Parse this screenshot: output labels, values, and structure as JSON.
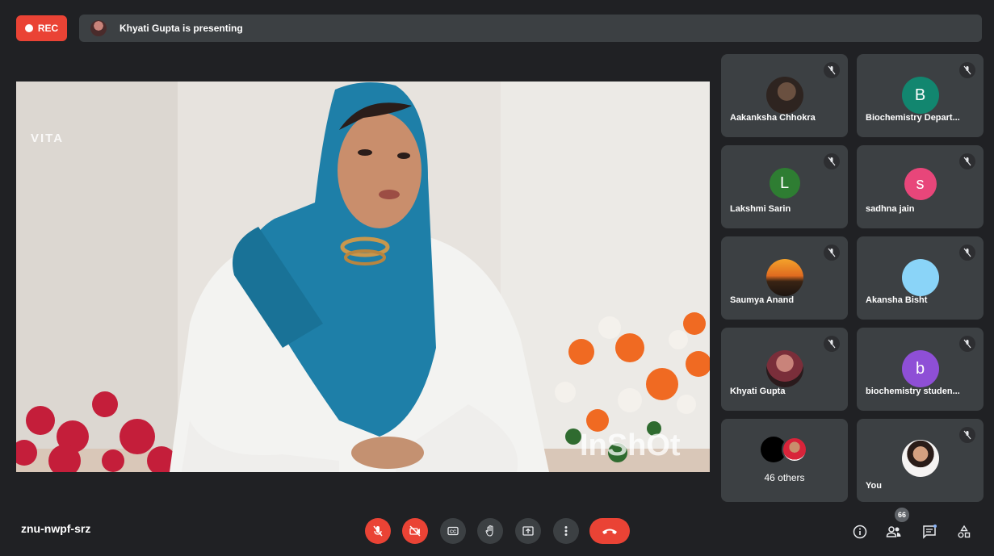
{
  "header": {
    "rec_label": "REC",
    "presenting_text": "Khyati Gupta is presenting"
  },
  "stage": {
    "watermark_top": "VITA",
    "watermark_bottom": "InShOt"
  },
  "participants": [
    {
      "name": "Aakanksha Chhokra",
      "avatar": "photo"
    },
    {
      "name": "Biochemistry Depart...",
      "initial": "B",
      "color": "#12866f"
    },
    {
      "name": "Lakshmi Sarin",
      "initial": "L",
      "color": "#2e7d32"
    },
    {
      "name": "sadhna jain",
      "initial": "s",
      "color": "#e8467a"
    },
    {
      "name": "Saumya Anand",
      "avatar": "sunset-photo"
    },
    {
      "name": "Akansha Bisht",
      "avatar": "plain",
      "color": "#8ad4f8"
    },
    {
      "name": "Khyati Gupta",
      "avatar": "photo"
    },
    {
      "name": "biochemistry studen...",
      "initial": "b",
      "color": "#8e4fd6"
    },
    {
      "name": "46 others"
    },
    {
      "name": "You",
      "avatar": "photo"
    }
  ],
  "footer": {
    "meeting_code": "znu-nwpf-srz",
    "participant_count": "66"
  },
  "icons": [
    "mic-off-icon",
    "camera-off-icon",
    "captions-icon",
    "raise-hand-icon",
    "present-icon",
    "more-options-icon",
    "end-call-icon",
    "info-icon",
    "people-icon",
    "chat-icon",
    "activities-icon"
  ]
}
